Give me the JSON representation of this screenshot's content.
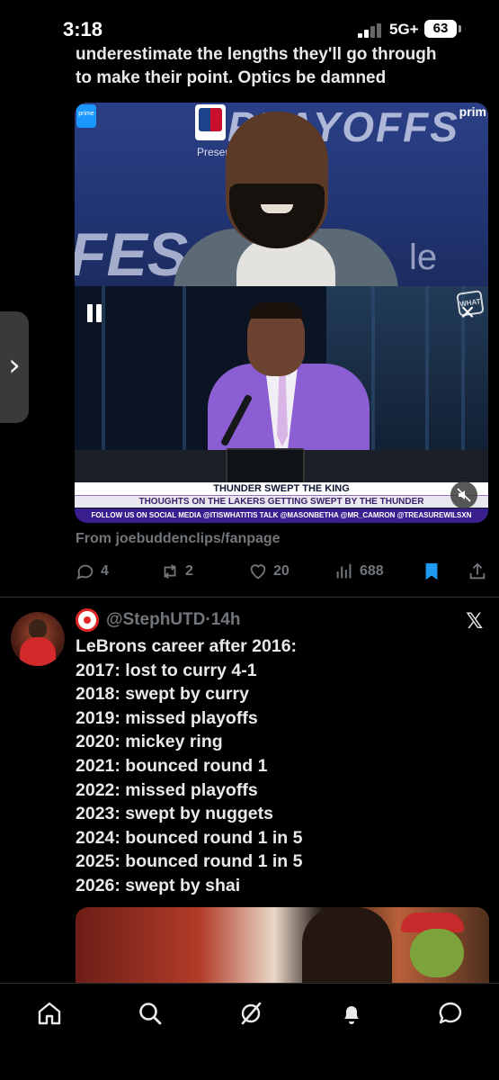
{
  "status_bar": {
    "time": "3:18",
    "network": "5G+",
    "battery": "63"
  },
  "tweet1": {
    "text_lines": [
      "underestimate the lengths they'll go through",
      "to make their point. Optics be damned"
    ],
    "video": {
      "top_panel": {
        "banner_text": "PLAYOFFS",
        "bg_text_left": "FES",
        "bg_text_right": "le",
        "presented_text": "Present",
        "prime_text": "prim"
      },
      "bottom_panel": {
        "logo_text": "WHAT",
        "headline": "THUNDER SWEPT THE KING",
        "subheadline": "THOUGHTS ON THE LAKERS GETTING SWEPT BY THE THUNDER",
        "ticker": "FOLLOW US ON SOCIAL MEDIA @ITISWHATITIS   TALK  @MASONBETHA @MR_CAMRON @TREASUREWILSXN"
      }
    },
    "source": "From joebuddenclips/fanpage",
    "actions": {
      "replies": "4",
      "reposts": "2",
      "likes": "20",
      "views": "688"
    },
    "accent_color": "#1d9bf0"
  },
  "tweet2": {
    "handle": "@StephUTD",
    "separator": "·",
    "time_ago": "14h",
    "lines": [
      "LeBrons career after 2016:",
      "2017: lost to curry 4-1",
      "2018: swept by curry",
      "2019: missed playoffs",
      "2020: mickey ring",
      "2021: bounced round 1",
      "2022: missed playoffs",
      "2023: swept by nuggets",
      "2024: bounced round 1 in 5",
      "2025: bounced round 1 in 5",
      "2026: swept by shai"
    ],
    "logo_glyph": "𝕏"
  },
  "edge_handle": {
    "glyph": "›"
  },
  "bottom_nav": {
    "items": [
      "home-icon",
      "search-icon",
      "grok-icon",
      "notifications-icon",
      "messages-icon"
    ]
  }
}
